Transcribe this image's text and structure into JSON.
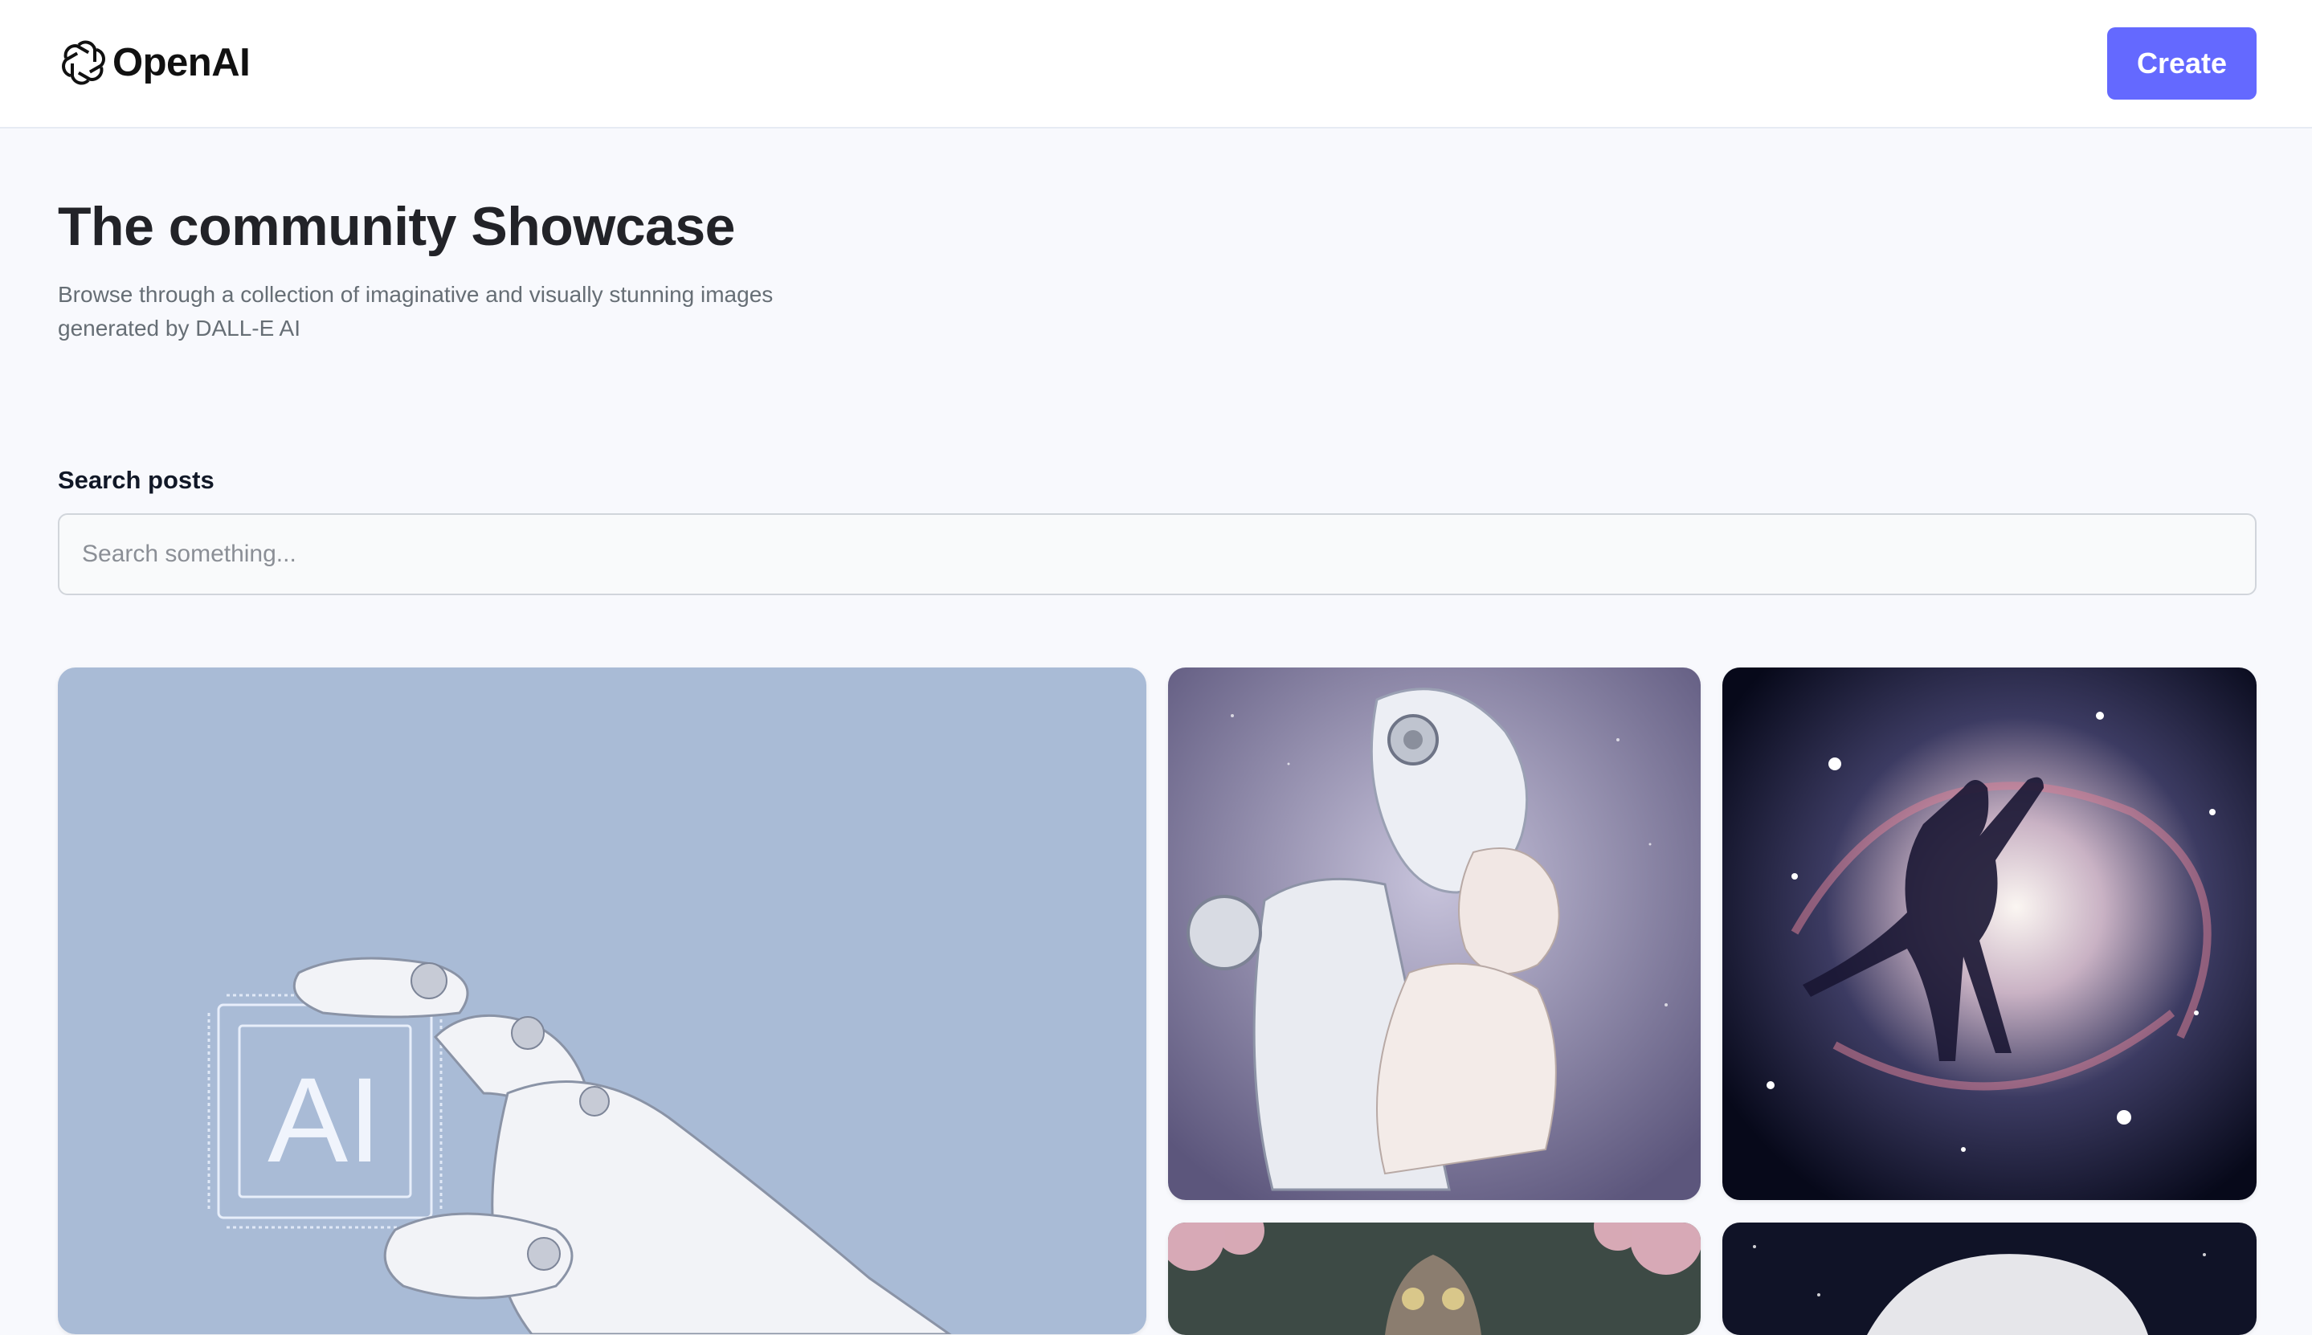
{
  "header": {
    "logo_text": "OpenAI",
    "create_label": "Create"
  },
  "hero": {
    "title": "The community Showcase",
    "subtitle": "Browse through a collection of imaginative and visually stunning images generated by DALL-E AI"
  },
  "search": {
    "label": "Search posts",
    "placeholder": "Search something...",
    "value": ""
  },
  "gallery": {
    "items": [
      {
        "subject": "Robotic hand holding AI chip",
        "overlay_text": "AI"
      },
      {
        "subject": "Robot mother holding a baby among stars"
      },
      {
        "subject": "Dancing couple silhouette in a galaxy"
      },
      {
        "subject": "Owl among pink blossoms"
      },
      {
        "subject": "Animal in space scene"
      }
    ]
  },
  "colors": {
    "accent": "#6469ff",
    "page_background": "#f8f9fd",
    "title_text": "#222328",
    "subtitle_text": "#666e75"
  }
}
